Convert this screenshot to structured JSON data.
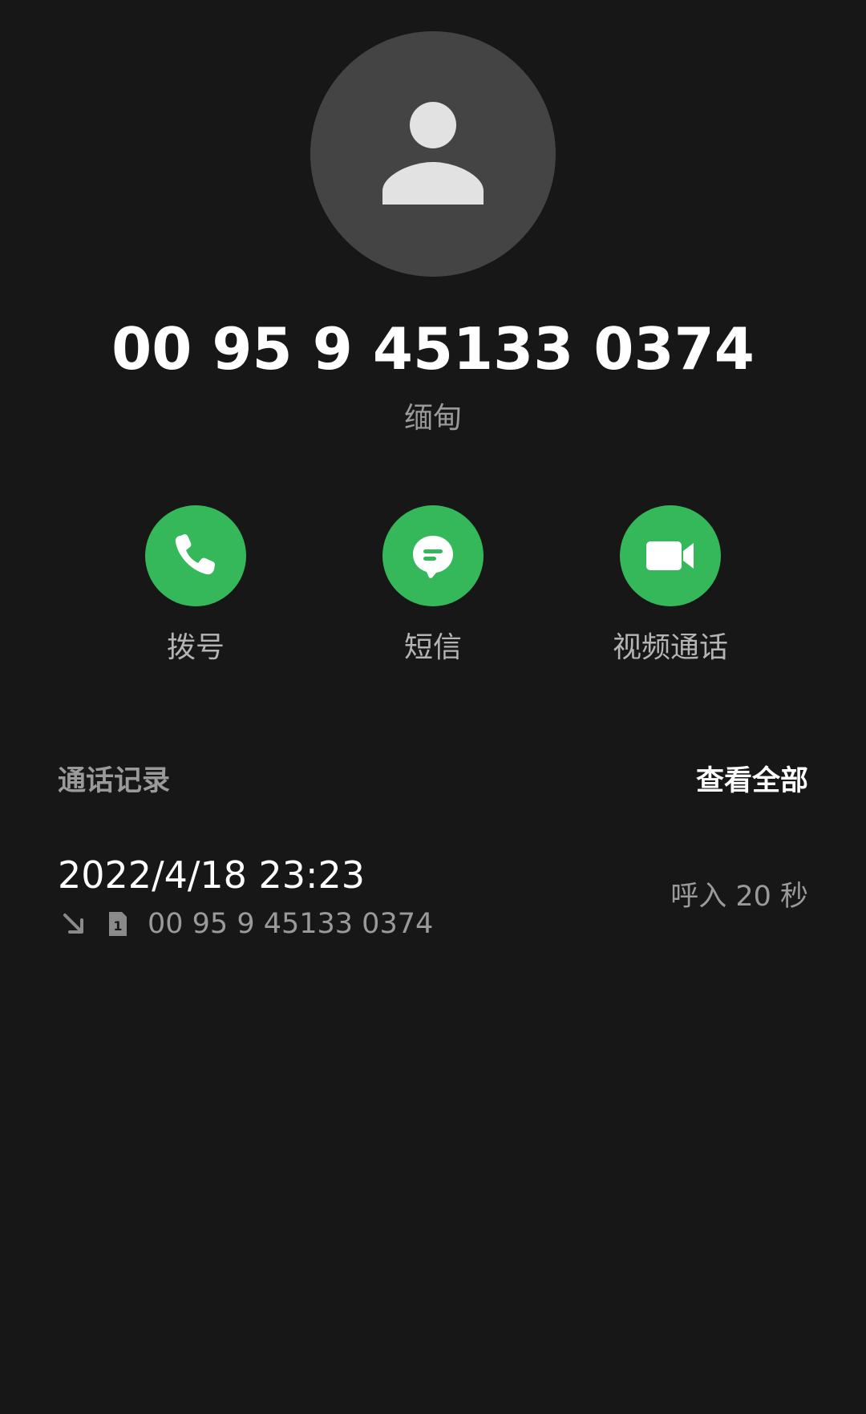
{
  "contact": {
    "avatar_icon": "person-icon",
    "phone_number": "00 95 9 45133 0374",
    "location": "缅甸"
  },
  "actions": [
    {
      "label": "拨号",
      "icon": "phone-icon"
    },
    {
      "label": "短信",
      "icon": "message-icon"
    },
    {
      "label": "视频通话",
      "icon": "video-camera-icon"
    }
  ],
  "call_log": {
    "title": "通话记录",
    "view_all": "查看全部",
    "entries": [
      {
        "datetime": "2022/4/18 23:23",
        "direction_icon": "incoming-arrow-icon",
        "sim_icon": "sim-1-icon",
        "number": "00 95 9 45133 0374",
        "type_duration": "呼入  20 秒"
      }
    ]
  },
  "colors": {
    "background": "#171717",
    "avatar": "#444444",
    "accent_green": "#34b85a",
    "muted_text": "#9a9a9a"
  }
}
